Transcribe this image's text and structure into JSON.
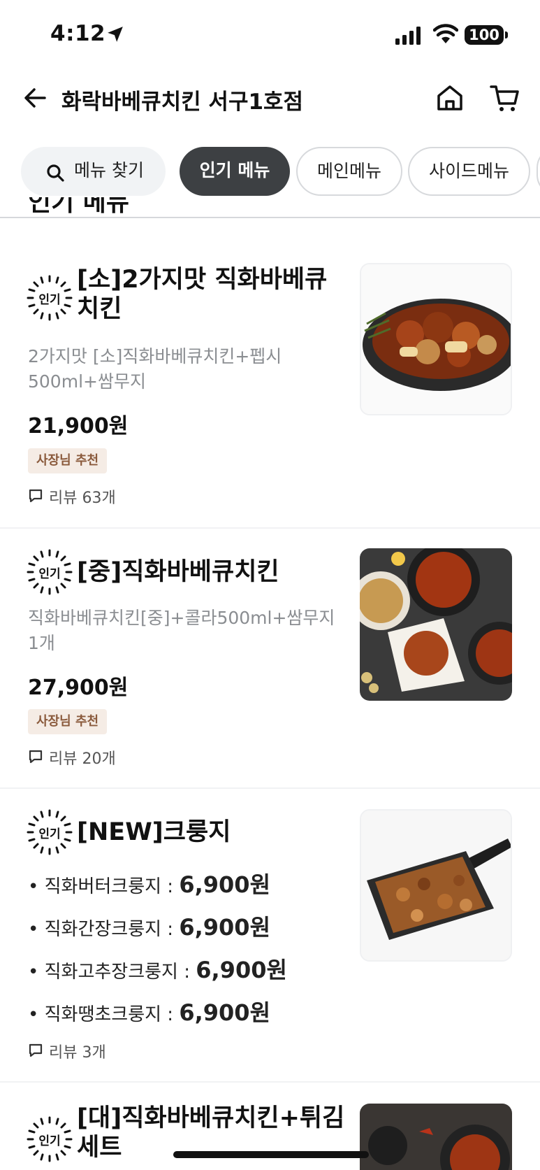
{
  "status_bar": {
    "time": "4:12",
    "battery": "100"
  },
  "header": {
    "title": "화락바베큐치킨 서구1호점"
  },
  "tabs": {
    "search_label": "메뉴 찾기",
    "items": [
      "인기 메뉴",
      "메인메뉴",
      "사이드메뉴"
    ]
  },
  "section": {
    "clipped_title": "인기 메뉴"
  },
  "popular_badge": "인기",
  "menu_items": [
    {
      "name": "[소]2가지맛 직화바베큐치킨",
      "description": "2가지맛 [소]직화바베큐치킨+펩시500ml+쌈무지",
      "price": "21,900원",
      "recommend": "사장님 추천",
      "reviews": "리뷰 63개"
    },
    {
      "name": "[중]직화바베큐치킨",
      "description": "직화바베큐치킨[중]+콜라500ml+쌈무지1개",
      "price": "27,900원",
      "recommend": "사장님 추천",
      "reviews": "리뷰 20개"
    },
    {
      "name": "[NEW]크룽지",
      "lines": [
        {
          "label": "• 직화버터크룽지 : ",
          "price": "6,900원"
        },
        {
          "label": "• 직화간장크룽지 : ",
          "price": "6,900원"
        },
        {
          "label": "• 직화고추장크룽지 : ",
          "price": "6,900원"
        },
        {
          "label": "• 직화땡초크룽지 : ",
          "price": "6,900원"
        }
      ],
      "reviews": "리뷰 3개"
    },
    {
      "name": "[대]직화바베큐치킨+튀김세트"
    }
  ]
}
